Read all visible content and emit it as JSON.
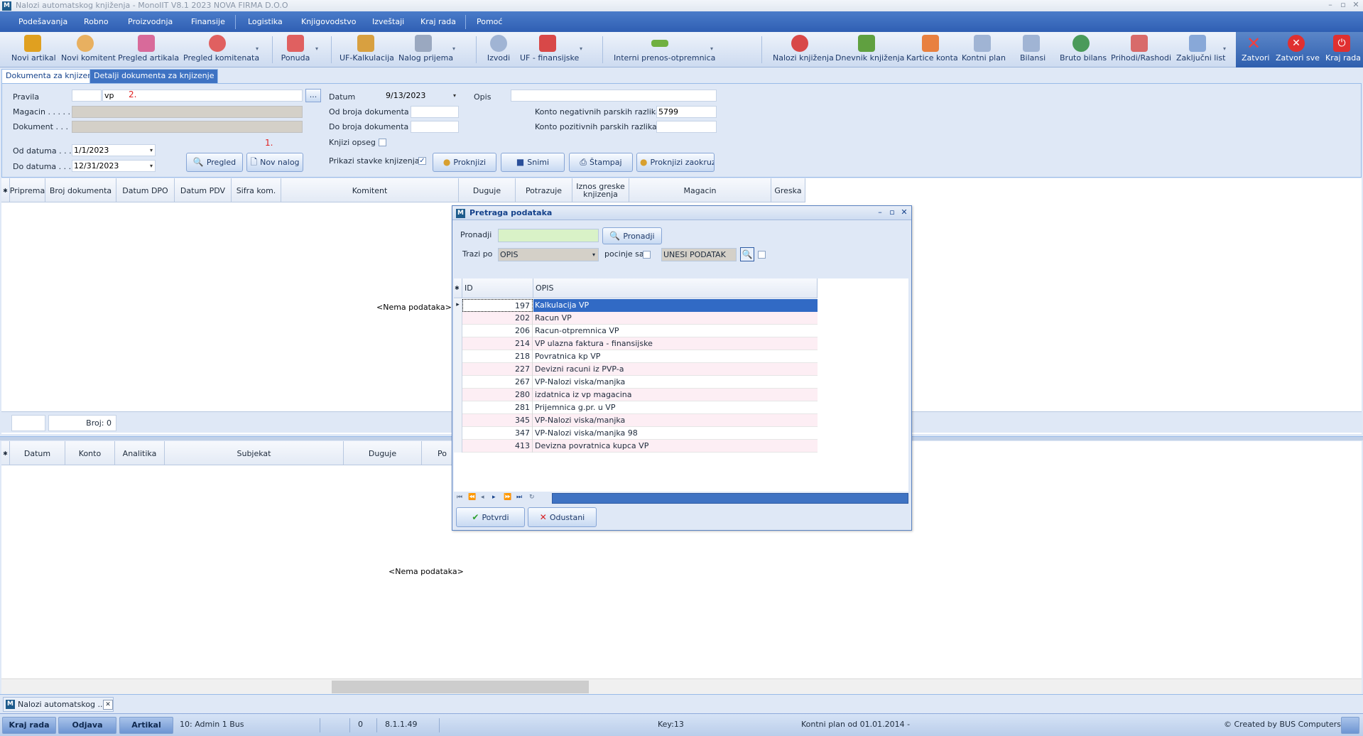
{
  "window": {
    "title": "Nalozi automatskog knjiženja - MonoIIT V8.1 2023 NOVA FIRMA D.O.O",
    "app_icon": "app-icon"
  },
  "menu": [
    "Podešavanja",
    "Robno",
    "Proizvodnja",
    "Finansije",
    "Logistika",
    "Knjigovodstvo",
    "Izveštaji",
    "Kraj rada",
    "Pomoć"
  ],
  "toolbar": [
    {
      "label": "Novi artikal",
      "icon": "box-icon",
      "color": "#e0a020"
    },
    {
      "label": "Novi komitent",
      "icon": "person-add-icon",
      "color": "#e8b060"
    },
    {
      "label": "Pregled artikala",
      "icon": "items-icon",
      "color": "#d86a9a"
    },
    {
      "label": "Pregled komitenata",
      "icon": "people-icon",
      "color": "#e06060"
    },
    {
      "label": "Ponuda",
      "icon": "offer-icon",
      "color": "#e06060"
    },
    {
      "label": "UF-Kalkulacija",
      "icon": "calc-icon",
      "color": "#d8a040"
    },
    {
      "label": "Nalog prijema",
      "icon": "receipt-icon",
      "color": "#9aa8c0"
    },
    {
      "label": "Izvodi",
      "icon": "statement-icon",
      "color": "#a0b4d4"
    },
    {
      "label": "UF - finansijske",
      "icon": "invoice-icon",
      "color": "#d84848"
    },
    {
      "label": "Interni prenos-otpremnica",
      "icon": "transfer-icon",
      "color": "#70b040"
    },
    {
      "label": "Nalozi knjiženja",
      "icon": "book-icon",
      "color": "#d84848"
    },
    {
      "label": "Dnevnik knjiženja",
      "icon": "journal-icon",
      "color": "#60a040"
    },
    {
      "label": "Kartice konta",
      "icon": "cards-icon",
      "color": "#e88040"
    },
    {
      "label": "Kontni plan",
      "icon": "plan-icon",
      "color": "#a0b4d4"
    },
    {
      "label": "Bilansi",
      "icon": "balance-icon",
      "color": "#a0b4d4"
    },
    {
      "label": "Bruto bilans",
      "icon": "globe-icon",
      "color": "#4a9a5a"
    },
    {
      "label": "Prihodi/Rashodi",
      "icon": "income-icon",
      "color": "#d86a6a"
    },
    {
      "label": "Zaključni list",
      "icon": "closing-icon",
      "color": "#88a8d8"
    },
    {
      "label": "Zatvori",
      "icon": "close-icon",
      "color": "#e03030"
    },
    {
      "label": "Zatvori sve",
      "icon": "close-all-icon",
      "color": "#e03030"
    },
    {
      "label": "Kraj rada",
      "icon": "power-icon",
      "color": "#e03030"
    }
  ],
  "tabs": [
    "Dokumenta za knjizenje",
    "Detalji dokumenta za knjizenje"
  ],
  "form": {
    "pravila_label": "Pravila",
    "pravila_value": "vp",
    "marker2": "2.",
    "magacin_label": "Magacin . . . . .",
    "dokument_label": "Dokument . . .",
    "od_datuma_label": "Od datuma . . .",
    "od_datuma_value": "1/1/2023",
    "do_datuma_label": "Do datuma . . .",
    "do_datuma_value": "12/31/2023",
    "marker1": "1.",
    "pregled_btn": "Pregled",
    "nov_nalog_btn": "Nov nalog",
    "datum_label": "Datum",
    "datum_value": "9/13/2023",
    "opis_label": "Opis",
    "od_broja_label": "Od broja dokumenta",
    "do_broja_label": "Do broja dokumenta",
    "knjizi_opseg_label": "Knjizi opseg",
    "prikazi_stavke_label": "Prikazi stavke knjizenja",
    "konto_neg_label": "Konto negativnih parskih razlika",
    "konto_neg_value": "5799",
    "konto_poz_label": "Konto pozitivnih parskih razlika",
    "proknjizi_btn": "Proknjizi",
    "snimi_btn": "Snimi",
    "stampaj_btn": "Štampaj",
    "proknjizi_zaokruz_btn": "Proknjizi zaokruzivanje"
  },
  "grid1": {
    "columns": [
      "Pripremа",
      "Broj dokumenta",
      "Datum DPO",
      "Datum PDV",
      "Sifra kom.",
      "Komitent",
      "Duguje",
      "Potrazuje",
      "Iznos greske knjizenja",
      "Magacin",
      "Greska"
    ],
    "empty_text": "<Nema podataka>",
    "count_label": "Broj: 0"
  },
  "grid2": {
    "columns": [
      "Datum",
      "Konto",
      "Analitika",
      "Subjekat",
      "Duguje",
      "Po"
    ],
    "empty_text": "<Nema podataka>"
  },
  "dialog": {
    "title": "Pretraga podataka",
    "pronadji_label": "Pronadji",
    "pronadji_btn": "Pronadji",
    "trazi_po_label": "Trazi po",
    "trazi_po_value": "OPIS",
    "pocinje_sa_label": "pocinje sa",
    "unesi_placeholder": "UNESI PODATAK",
    "columns": [
      "ID",
      "OPIS"
    ],
    "rows": [
      {
        "id": "197",
        "opis": "Kalkulacija VP"
      },
      {
        "id": "202",
        "opis": "Racun VP"
      },
      {
        "id": "206",
        "opis": "Racun-otpremnica VP"
      },
      {
        "id": "214",
        "opis": "VP ulazna faktura - finansijske"
      },
      {
        "id": "218",
        "opis": "Povratnica kp  VP"
      },
      {
        "id": "227",
        "opis": "Devizni racuni iz PVP-a"
      },
      {
        "id": "267",
        "opis": "VP-Nalozi viska/manjka"
      },
      {
        "id": "280",
        "opis": "izdatnica iz vp magacina"
      },
      {
        "id": "281",
        "opis": "Prijemnica g.pr. u VP"
      },
      {
        "id": "345",
        "opis": "VP-Nalozi viska/manjka"
      },
      {
        "id": "347",
        "opis": "VP-Nalozi viska/manjka 98"
      },
      {
        "id": "413",
        "opis": "Devizna povratnica kupca  VP"
      }
    ],
    "potvrdi_btn": "Potvrdi",
    "odustani_btn": "Odustani"
  },
  "doc_tab": "Nalozi automatskog ...",
  "status": {
    "kraj_rada": "Kraj rada",
    "odjava": "Odjava",
    "artikal": "Artikal",
    "user": "10: Admin 1 Bus",
    "zero": "0",
    "version": "8.1.1.49",
    "key": "Key:13",
    "kontni_plan": "Kontni plan od 01.01.2014 -",
    "credit": "© Created by BUS Computers"
  }
}
